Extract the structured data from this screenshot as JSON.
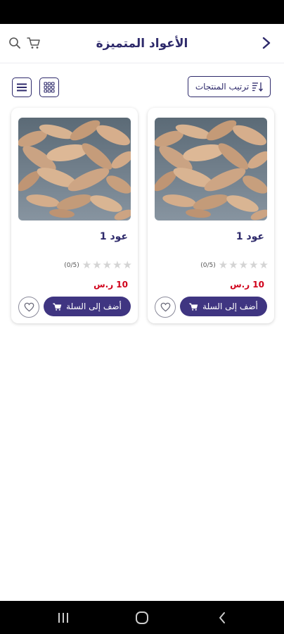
{
  "header": {
    "title": "الأعواد المتميزة"
  },
  "toolbar": {
    "sort_label": "ترتيب المنتجات"
  },
  "products": [
    {
      "name": "عود 1",
      "rating_count": "(0/5)",
      "rating": 0,
      "price": "10 ر.س",
      "add_to_cart_label": "أضف إلى السلة"
    },
    {
      "name": "عود 1",
      "rating_count": "(0/5)",
      "rating": 0,
      "price": "10 ر.س",
      "add_to_cart_label": "أضف إلى السلة"
    }
  ],
  "colors": {
    "primary": "#2e2a6b",
    "button": "#3f3581",
    "price": "#d0021b",
    "star_empty": "#d4d4d4"
  },
  "icons": {
    "back": "chevron-right-icon",
    "cart": "cart-icon",
    "search": "search-icon",
    "grid": "grid-view-icon",
    "list": "list-view-icon",
    "sort": "sort-icon",
    "favorite": "heart-icon"
  }
}
